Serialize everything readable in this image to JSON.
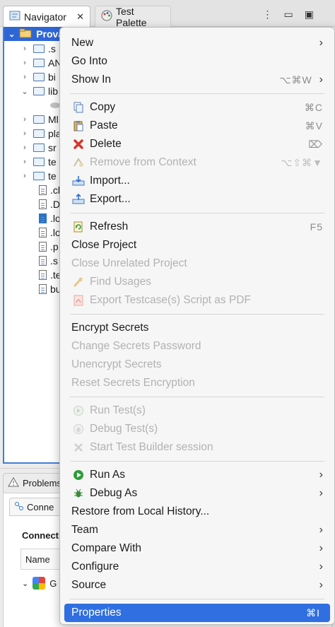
{
  "tabs": {
    "navigator": "Navigator",
    "test_palette": "Test Palette"
  },
  "tree": {
    "root": "Prova",
    "items": [
      ".s",
      "AN",
      "bi",
      "lib",
      "Ml",
      "pla",
      "sr",
      "te",
      "te",
      ".cl",
      ".D",
      ".lo",
      ".lo",
      ".p",
      ".s",
      ".te",
      "bu"
    ]
  },
  "bottom": {
    "problems_tab": "Problems",
    "connections_tab": "Conne",
    "heading": "Connecti",
    "column_name": "Name",
    "connection_item": "G"
  },
  "menu": {
    "group1": [
      {
        "label": "New",
        "submenu": true
      },
      {
        "label": "Go Into"
      },
      {
        "label": "Show In",
        "shortcut": "⌥⌘W",
        "submenu": true
      }
    ],
    "group2": [
      {
        "label": "Copy",
        "icon": "copy-icon",
        "shortcut": "⌘C"
      },
      {
        "label": "Paste",
        "icon": "paste-icon",
        "shortcut": "⌘V"
      },
      {
        "label": "Delete",
        "icon": "delete-icon",
        "shortcut": "⌦"
      },
      {
        "label": "Remove from Context",
        "icon": "remove-context-icon",
        "shortcut": "⌥⇧⌘▼",
        "disabled": true
      },
      {
        "label": "Import...",
        "icon": "import-icon"
      },
      {
        "label": "Export...",
        "icon": "export-icon"
      }
    ],
    "group3": [
      {
        "label": "Refresh",
        "icon": "refresh-icon",
        "shortcut": "F5"
      },
      {
        "label": "Close Project"
      },
      {
        "label": "Close Unrelated Project",
        "disabled": true
      },
      {
        "label": "Find Usages",
        "icon": "find-usages-icon",
        "disabled": true
      },
      {
        "label": "Export Testcase(s) Script as PDF",
        "icon": "pdf-icon",
        "disabled": true
      }
    ],
    "group4": [
      {
        "label": "Encrypt Secrets"
      },
      {
        "label": "Change Secrets Password",
        "disabled": true
      },
      {
        "label": "Unencrypt Secrets",
        "disabled": true
      },
      {
        "label": "Reset Secrets Encryption",
        "disabled": true
      }
    ],
    "group5": [
      {
        "label": "Run Test(s)",
        "icon": "run-test-icon",
        "disabled": true
      },
      {
        "label": "Debug Test(s)",
        "icon": "debug-test-icon",
        "disabled": true
      },
      {
        "label": "Start Test Builder session",
        "icon": "test-builder-icon",
        "disabled": true
      }
    ],
    "group6": [
      {
        "label": "Run As",
        "icon": "run-as-icon",
        "submenu": true
      },
      {
        "label": "Debug As",
        "icon": "debug-as-icon",
        "submenu": true
      },
      {
        "label": "Restore from Local History..."
      },
      {
        "label": "Team",
        "submenu": true
      },
      {
        "label": "Compare With",
        "submenu": true
      },
      {
        "label": "Configure",
        "submenu": true
      },
      {
        "label": "Source",
        "submenu": true
      }
    ],
    "group7": [
      {
        "label": "Properties",
        "shortcut": "⌘I",
        "highlighted": true
      }
    ]
  },
  "colors": {
    "selection": "#2f66d6",
    "menu_highlight": "#2f6fe1",
    "delete_icon": "#d9342b",
    "run_icon": "#2e9d3a"
  }
}
